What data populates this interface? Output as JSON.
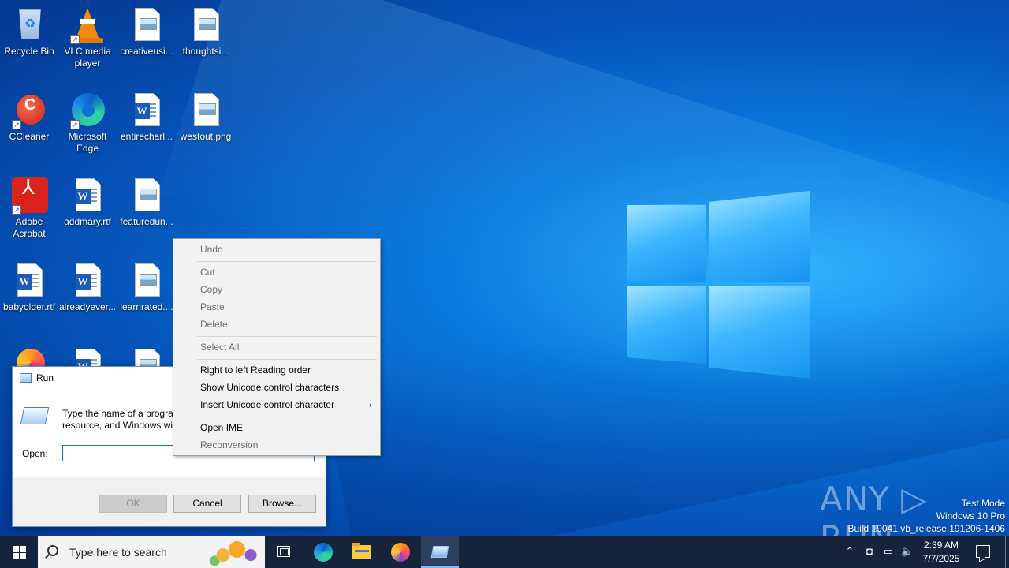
{
  "desktop": {
    "icons": [
      {
        "label": "Recycle Bin",
        "icon": "recycle-bin-icon"
      },
      {
        "label": "VLC media player",
        "icon": "vlc-icon"
      },
      {
        "label": "creativeusi...",
        "icon": "image-file-icon"
      },
      {
        "label": "thoughtsi...",
        "icon": "image-file-icon"
      },
      {
        "label": "CCleaner",
        "icon": "ccleaner-icon"
      },
      {
        "label": "Microsoft Edge",
        "icon": "edge-icon"
      },
      {
        "label": "entirecharl...",
        "icon": "word-document-icon"
      },
      {
        "label": "westout.png",
        "icon": "image-file-icon"
      },
      {
        "label": "Adobe Acrobat",
        "icon": "acrobat-icon"
      },
      {
        "label": "addmary.rtf",
        "icon": "word-document-icon"
      },
      {
        "label": "featuredun...",
        "icon": "image-file-icon"
      },
      {
        "label": "babyolder.rtf",
        "icon": "word-document-icon"
      },
      {
        "label": "alreadyever...",
        "icon": "word-document-icon"
      },
      {
        "label": "learnrated....",
        "icon": "image-file-icon"
      }
    ]
  },
  "run_dialog": {
    "title": "Run",
    "message": "Type the name of a program, folder, document, or Internet resource, and Windows will open it for you.",
    "open_label": "Open:",
    "open_value": "",
    "ok_label": "OK",
    "cancel_label": "Cancel",
    "browse_label": "Browse..."
  },
  "context_menu": {
    "items": [
      {
        "label": "Undo",
        "enabled": false
      },
      {
        "label": "Cut",
        "enabled": false
      },
      {
        "label": "Copy",
        "enabled": false
      },
      {
        "label": "Paste",
        "enabled": false
      },
      {
        "label": "Delete",
        "enabled": false
      },
      {
        "label": "Select All",
        "enabled": false
      },
      {
        "label": "Right to left Reading order",
        "enabled": true
      },
      {
        "label": "Show Unicode control characters",
        "enabled": true
      },
      {
        "label": "Insert Unicode control character",
        "enabled": true,
        "submenu": true
      },
      {
        "label": "Open IME",
        "enabled": true
      },
      {
        "label": "Reconversion",
        "enabled": false
      }
    ],
    "submenu_arrow": "›"
  },
  "watermark": {
    "brand": "ANY ▷ RUN",
    "test_mode": "Test Mode",
    "edition": "Windows 10 Pro",
    "build": "Build 19041.vb_release.191206-1406"
  },
  "taskbar": {
    "search_placeholder": "Type here to search",
    "clock_time": "2:39 AM",
    "clock_date": "7/7/2025",
    "tray_icons": [
      "chevron-up-icon",
      "meet-now-icon",
      "network-icon",
      "volume-icon"
    ],
    "pinned": [
      "task-view-icon",
      "edge-icon",
      "file-explorer-icon",
      "firefox-icon",
      "run-icon"
    ]
  },
  "colors": {
    "taskbar_bg": "#15233b",
    "accent": "#0078d7",
    "menu_bg": "#f2f2f2",
    "disabled_text": "#6d6d6d"
  }
}
